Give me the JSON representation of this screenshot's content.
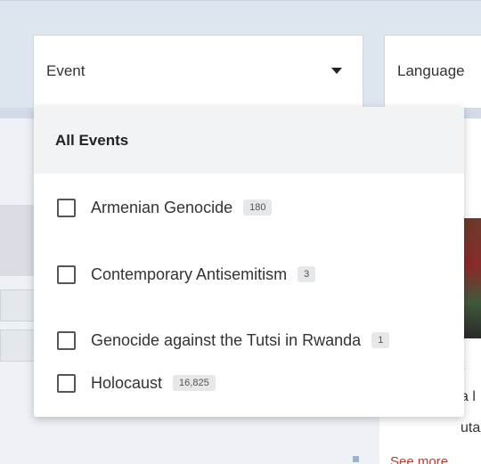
{
  "filters": {
    "event": {
      "label": "Event"
    },
    "language": {
      "label": "Language"
    }
  },
  "dropdown": {
    "header": "All Events",
    "options": [
      {
        "label": "Armenian Genocide",
        "count": "180"
      },
      {
        "label": "Contemporary Antisemitism",
        "count": "3"
      },
      {
        "label": "Genocide against the Tutsi in Rwanda",
        "count": "1"
      },
      {
        "label": "Holocaust",
        "count": "16,825"
      }
    ]
  },
  "background": {
    "card_text_lines": [
      "t",
      "a l",
      "uta"
    ],
    "see_more": "See more"
  },
  "colors": {
    "accent_link": "#c0392b",
    "badge_bg": "#e6e7e9",
    "header_bg": "#f2f3f5"
  }
}
